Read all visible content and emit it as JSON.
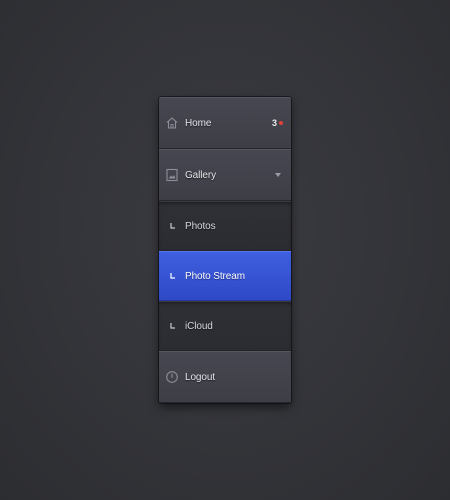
{
  "menu": {
    "home": {
      "label": "Home",
      "badge": "3",
      "icon": "home-icon"
    },
    "gallery": {
      "label": "Gallery",
      "icon": "image-icon",
      "expanded": true
    },
    "sub_items": [
      {
        "label": "Photos",
        "icon": "corner-arrow-icon",
        "active": false
      },
      {
        "label": "Photo Stream",
        "icon": "corner-arrow-icon",
        "active": true
      },
      {
        "label": "iCloud",
        "icon": "corner-arrow-icon",
        "active": false
      }
    ],
    "logout": {
      "label": "Logout",
      "icon": "power-icon"
    }
  },
  "colors": {
    "background": "#333439",
    "active": "#3550d6",
    "badge_dot": "#e0413a"
  }
}
